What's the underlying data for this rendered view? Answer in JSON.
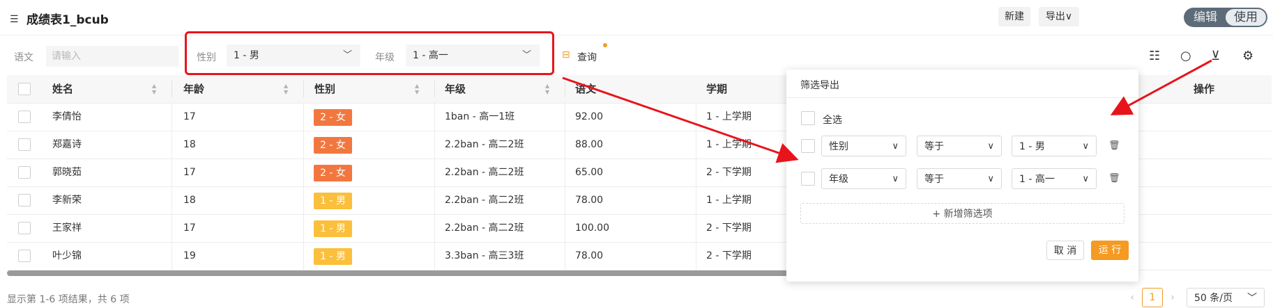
{
  "header": {
    "title": "成绩表1_bcub",
    "new_label": "新建",
    "export_label": "导出∨",
    "mode_edit": "编辑",
    "mode_use": "使用"
  },
  "filter_bar": {
    "chinese_label": "语文",
    "chinese_placeholder": "请输入",
    "gender_label": "性别",
    "gender_value": "1 - 男",
    "grade_label": "年级",
    "grade_value": "1 - 高一",
    "query_label": "查询"
  },
  "table": {
    "columns": [
      "姓名",
      "年龄",
      "性别",
      "年级",
      "语文",
      "学期",
      "操作"
    ],
    "rows": [
      {
        "name": "李倩怡",
        "age": "17",
        "gender": "2 - 女",
        "grade": "1ban - 高一1班",
        "chinese": "92.00",
        "term": "1 - 上学期"
      },
      {
        "name": "郑嘉诗",
        "age": "18",
        "gender": "2 - 女",
        "grade": "2.2ban - 高二2班",
        "chinese": "88.00",
        "term": "1 - 上学期"
      },
      {
        "name": "郭晓茹",
        "age": "17",
        "gender": "2 - 女",
        "grade": "2.2ban - 高二2班",
        "chinese": "65.00",
        "term": "2 - 下学期"
      },
      {
        "name": "李新荣",
        "age": "18",
        "gender": "1 - 男",
        "grade": "2.2ban - 高二2班",
        "chinese": "78.00",
        "term": "1 - 上学期"
      },
      {
        "name": "王家祥",
        "age": "17",
        "gender": "1 - 男",
        "grade": "2.2ban - 高二2班",
        "chinese": "100.00",
        "term": "2 - 下学期"
      },
      {
        "name": "叶少锦",
        "age": "19",
        "gender": "1 - 男",
        "grade": "3.3ban - 高三3班",
        "chinese": "78.00",
        "term": "2 - 下学期"
      }
    ]
  },
  "footer": {
    "summary": "显示第 1-6 项结果，共 6 项",
    "current_page": "1",
    "page_size": "50 条/页"
  },
  "popover": {
    "title": "筛选导出",
    "select_all": "全选",
    "conditions": [
      {
        "field": "性别",
        "operator": "等于",
        "value": "1 - 男"
      },
      {
        "field": "年级",
        "operator": "等于",
        "value": "1 - 高一"
      }
    ],
    "add_condition": "+ 新增筛选项",
    "cancel_label": "取 消",
    "run_label": "运 行"
  },
  "colors": {
    "tag_female": "#f2773f",
    "tag_male": "#fbbf3c",
    "primary": "#f59a23",
    "annotation_red": "#e8141b"
  }
}
